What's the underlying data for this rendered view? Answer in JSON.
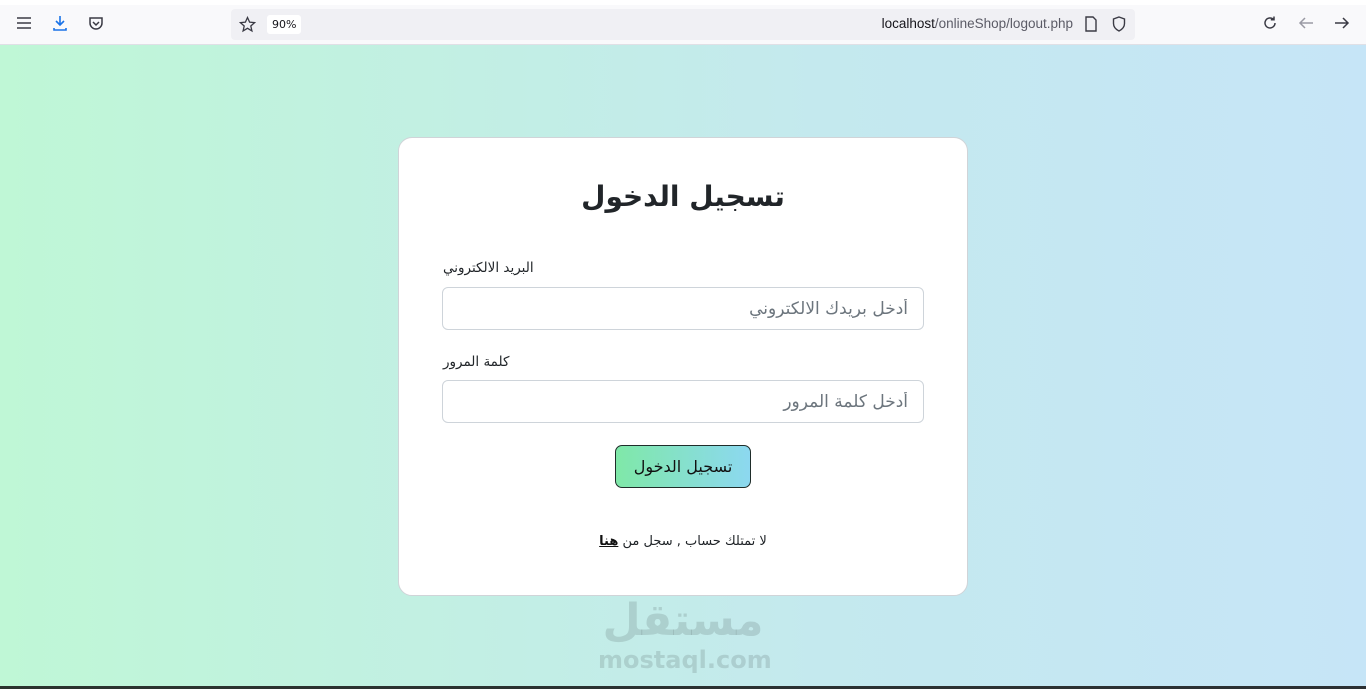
{
  "browser": {
    "zoom": "90%",
    "url_host": "localhost",
    "url_path": "/onlineShop/logout.php",
    "icons": [
      "menu-icon",
      "download-icon",
      "pocket-icon",
      "star-icon",
      "page-icon",
      "shield-icon",
      "reload-icon",
      "back-icon",
      "forward-icon"
    ]
  },
  "login": {
    "title": "تسجيل الدخول",
    "email_label": "البريد الالكتروني",
    "email_placeholder": "أدخل بريدك الالكتروني",
    "password_label": "كلمة المرور",
    "password_placeholder": "أدخل كلمة المرور",
    "submit_label": "تسجيل الدخول",
    "signup_text": "لا تمتلك حساب , سجل من ",
    "signup_link": "هنا"
  },
  "watermark": {
    "arabic": "مستقل",
    "latin": "mostaql.com"
  },
  "colors": {
    "gradient_start": "#bff7d6",
    "gradient_end": "#c6e5f7"
  }
}
